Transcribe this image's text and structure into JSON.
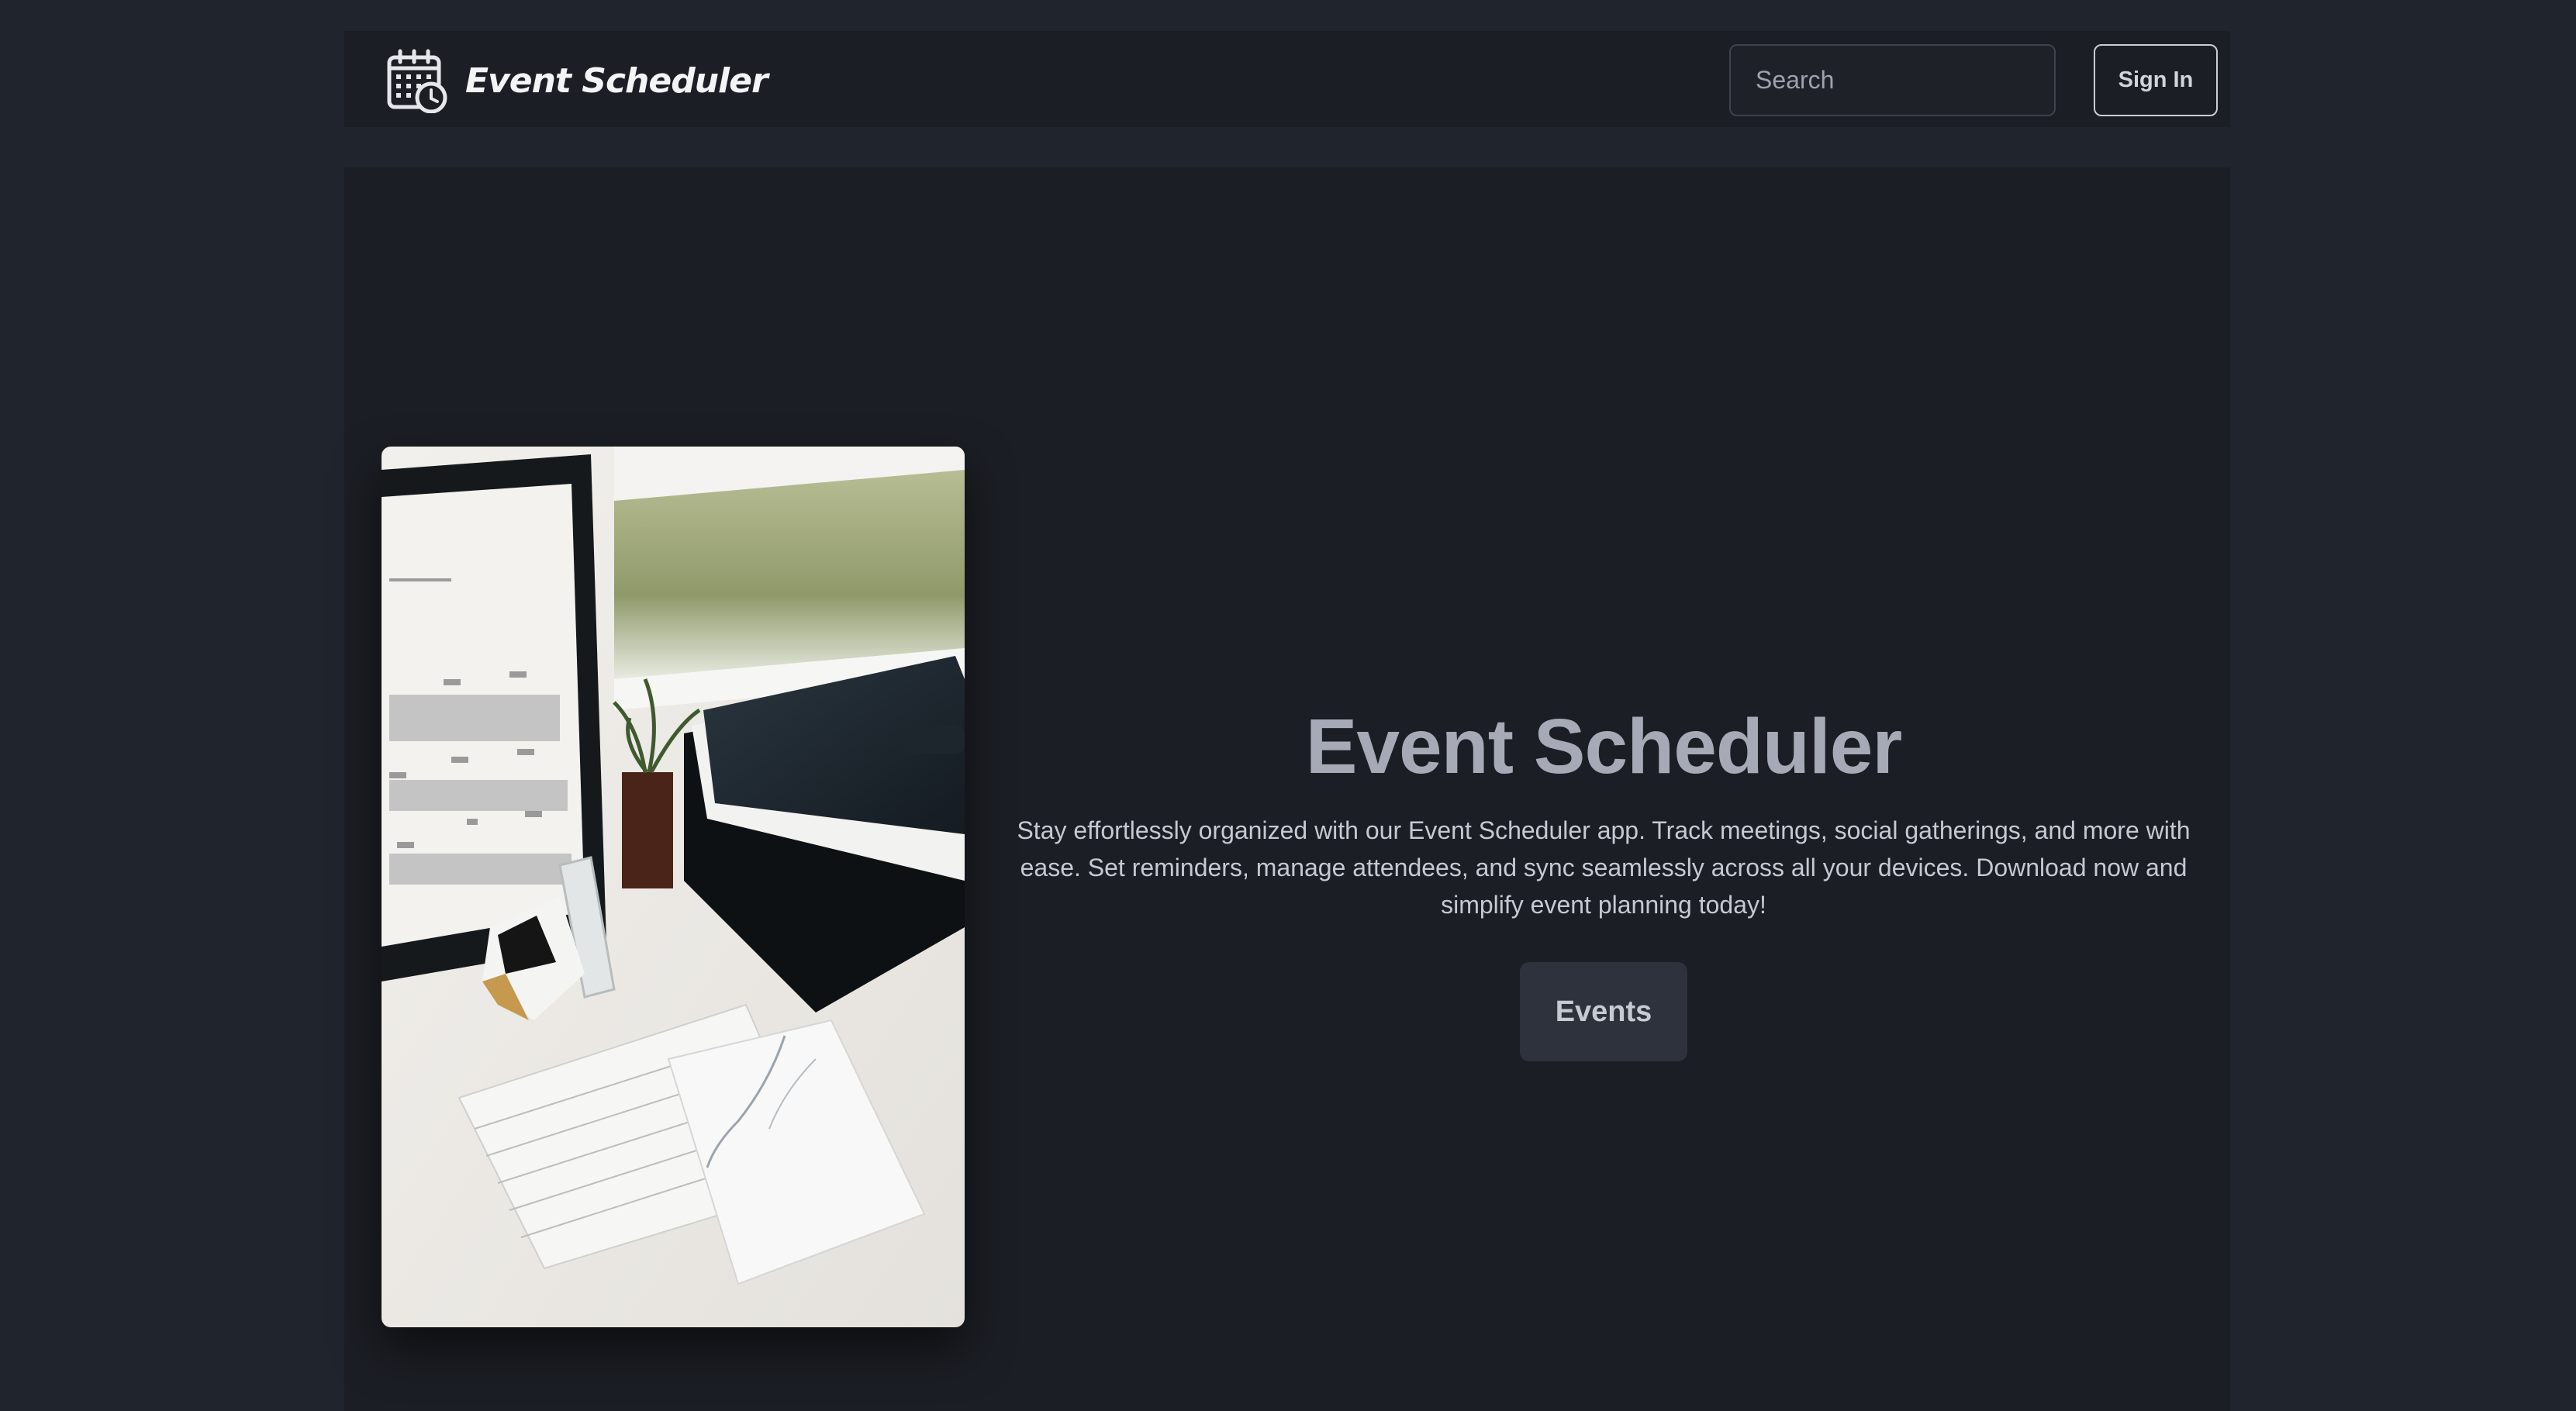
{
  "navbar": {
    "brand_name": "Event Scheduler",
    "brand_icon": "calendar-clock-icon",
    "search_placeholder": "Search",
    "signin_label": "Sign In"
  },
  "hero": {
    "image": "desk-calendar-photo",
    "title": "Event Scheduler",
    "description": "Stay effortlessly organized with our Event Scheduler app. Track meetings, social gatherings, and more with ease. Set reminders, manage attendees, and sync seamlessly across all your devices. Download now and simplify event planning today!",
    "button_label": "Events"
  },
  "colors": {
    "page_background": "#20242c",
    "panel_background": "#1b1e24",
    "title_text": "#a6aab6",
    "button_background": "#2d323c"
  }
}
